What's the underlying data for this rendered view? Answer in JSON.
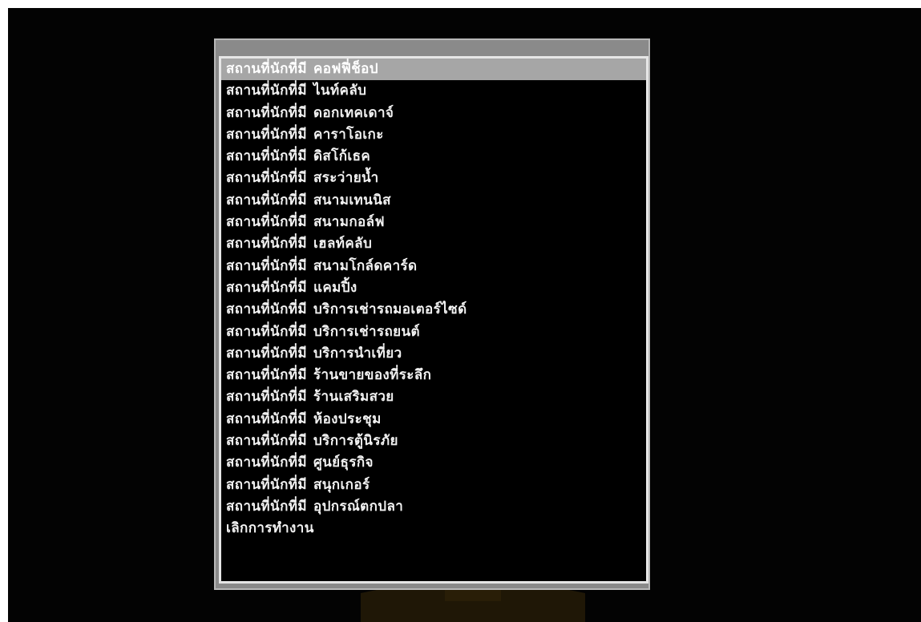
{
  "dialog": {
    "items": [
      {
        "prefix": "สถานที่นักที่มี",
        "label": "คอฟฟี่ช็อป",
        "selected": true
      },
      {
        "prefix": "สถานที่นักที่มี",
        "label": "ไนท์คลับ"
      },
      {
        "prefix": "สถานที่นักที่มี",
        "label": "ดอกเทคเดาจ์"
      },
      {
        "prefix": "สถานที่นักที่มี",
        "label": "คาราโอเกะ"
      },
      {
        "prefix": "สถานที่นักที่มี",
        "label": "ดิสโก้เธค"
      },
      {
        "prefix": "สถานที่นักที่มี",
        "label": "สระว่ายน้ำ"
      },
      {
        "prefix": "สถานที่นักที่มี",
        "label": "สนามเทนนิส"
      },
      {
        "prefix": "สถานที่นักที่มี",
        "label": "สนามกอล์ฟ"
      },
      {
        "prefix": "สถานที่นักที่มี",
        "label": "เฮลท์คลับ"
      },
      {
        "prefix": "สถานที่นักที่มี",
        "label": "สนามโกล์ดคาร์ด"
      },
      {
        "prefix": "สถานที่นักที่มี",
        "label": "แคมปิ้ง"
      },
      {
        "prefix": "สถานที่นักที่มี",
        "label": "บริการเช่ารถมอเตอร์ไซด์"
      },
      {
        "prefix": "สถานที่นักที่มี",
        "label": "บริการเช่ารถยนต์"
      },
      {
        "prefix": "สถานที่นักที่มี",
        "label": "บริการนำเที่ยว"
      },
      {
        "prefix": "สถานที่นักที่มี",
        "label": "ร้านขายของที่ระลึก"
      },
      {
        "prefix": "สถานที่นักที่มี",
        "label": "ร้านเสริมสวย"
      },
      {
        "prefix": "สถานที่นักที่มี",
        "label": "ห้องประชุม"
      },
      {
        "prefix": "สถานที่นักที่มี",
        "label": "บริการตู้นิรภัย"
      },
      {
        "prefix": "สถานที่นักที่มี",
        "label": "ศูนย์ธุรกิจ"
      },
      {
        "prefix": "สถานที่นักที่มี",
        "label": "สนุกเกอร์"
      },
      {
        "prefix": "สถานที่นักที่มี",
        "label": "อุปกรณ์ตกปลา"
      },
      {
        "prefix": "",
        "label": "เลิกการทำงาน"
      }
    ]
  },
  "colors": {
    "screen_bg": "#030303",
    "frame": "#8a8a8a",
    "border": "#e6e6e6",
    "highlight": "#a6a6a6",
    "text": "#f2f2f2",
    "watermark": "#7a5a12"
  }
}
